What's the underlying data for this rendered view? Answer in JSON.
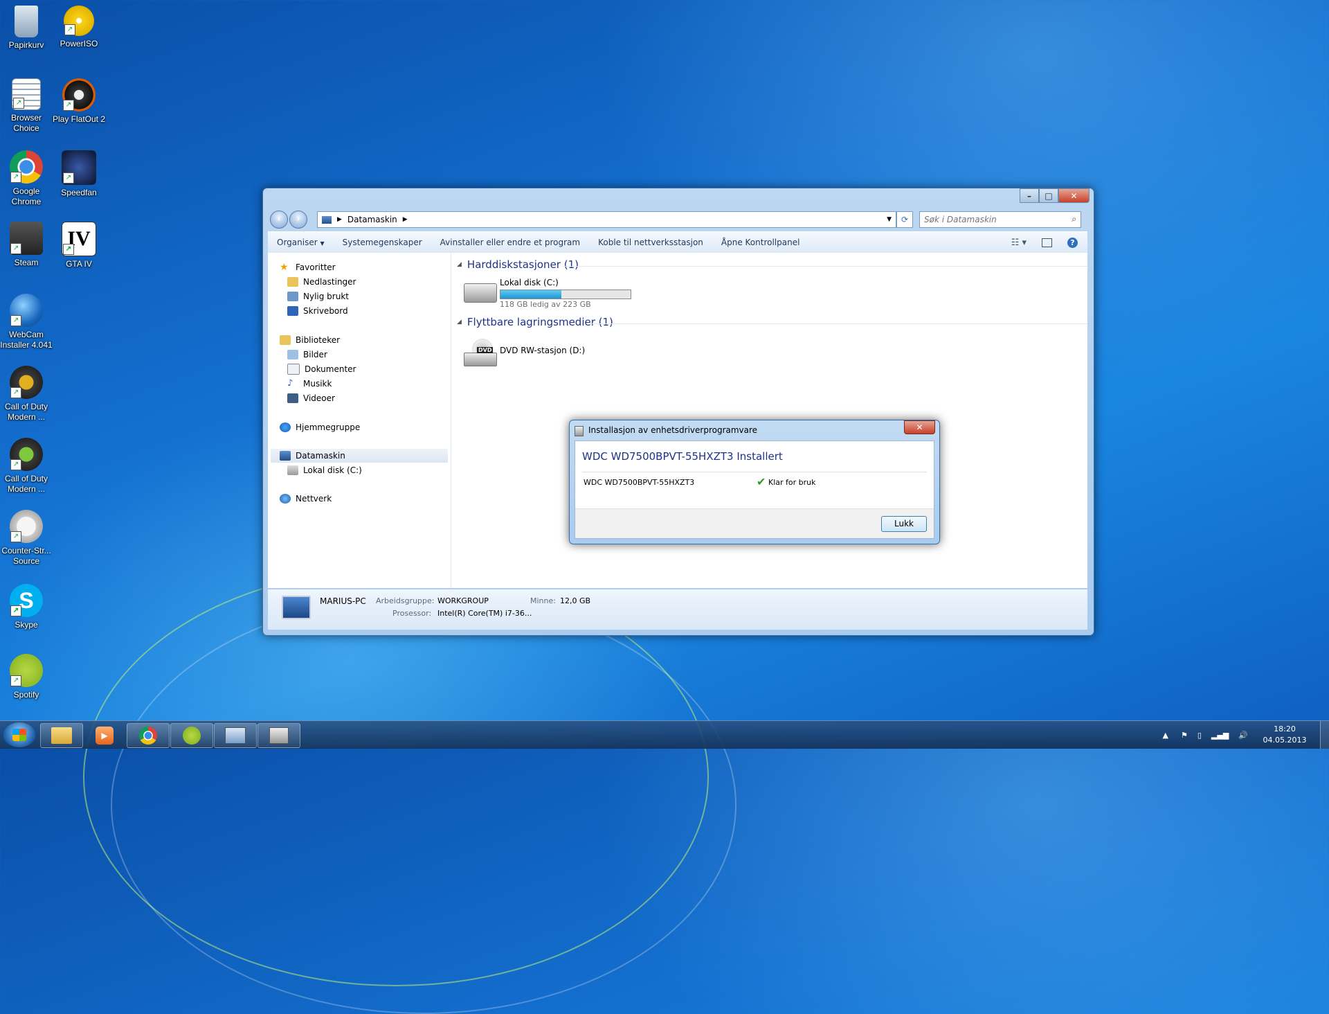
{
  "desktop_icons": [
    {
      "label": "Papirkurv"
    },
    {
      "label": "PowerISO"
    },
    {
      "label": "Browser Choice"
    },
    {
      "label": "Play FlatOut 2"
    },
    {
      "label": "Google Chrome"
    },
    {
      "label": "Speedfan"
    },
    {
      "label": "Steam"
    },
    {
      "label": "GTA IV"
    },
    {
      "label": "WebCam Installer 4.041"
    },
    {
      "label": "Call of Duty Modern ..."
    },
    {
      "label": "Call of Duty Modern ..."
    },
    {
      "label": "Counter-Str... Source"
    },
    {
      "label": "Skype"
    },
    {
      "label": "Spotify"
    }
  ],
  "explorer": {
    "address": "Datamaskin",
    "search_placeholder": "Søk i Datamaskin",
    "toolbar": {
      "organize": "Organiser",
      "system_properties": "Systemegenskaper",
      "uninstall": "Avinstaller eller endre et program",
      "map_network": "Koble til nettverksstasjon",
      "control_panel": "Åpne Kontrollpanel"
    },
    "nav": {
      "favorites": "Favoritter",
      "downloads": "Nedlastinger",
      "recent": "Nylig brukt",
      "desktop": "Skrivebord",
      "libraries": "Biblioteker",
      "pictures": "Bilder",
      "documents": "Dokumenter",
      "music": "Musikk",
      "videos": "Videoer",
      "homegroup": "Hjemmegruppe",
      "computer": "Datamaskin",
      "local_disk": "Lokal disk (C:)",
      "network": "Nettverk"
    },
    "groups": {
      "hard_drives": "Harddiskstasjoner (1)",
      "removable": "Flyttbare lagringsmedier (1)"
    },
    "drive_c": {
      "name": "Lokal disk (C:)",
      "free_text": "118 GB ledig av 223 GB",
      "used_fraction": 0.47
    },
    "drive_d": {
      "name": "DVD RW-stasjon (D:)",
      "icon_text": "DVD"
    },
    "details": {
      "pc_name": "MARIUS-PC",
      "workgroup_label": "Arbeidsgruppe:",
      "workgroup_value": "WORKGROUP",
      "memory_label": "Minne:",
      "memory_value": "12,0 GB",
      "processor_label": "Prosessor:",
      "processor_value": "Intel(R) Core(TM) i7-36..."
    }
  },
  "dialog": {
    "title": "Installasjon av enhetsdriverprogramvare",
    "heading": "WDC WD7500BPVT-55HXZT3 Installert",
    "device": "WDC WD7500BPVT-55HXZT3",
    "status": "Klar for bruk",
    "close_button": "Lukk"
  },
  "taskbar": {
    "time": "18:20",
    "date": "04.05.2013"
  },
  "colors": {
    "accent": "#1e3287",
    "disk_bar": "#26a0da",
    "status_ok": "#2a9a2a"
  }
}
